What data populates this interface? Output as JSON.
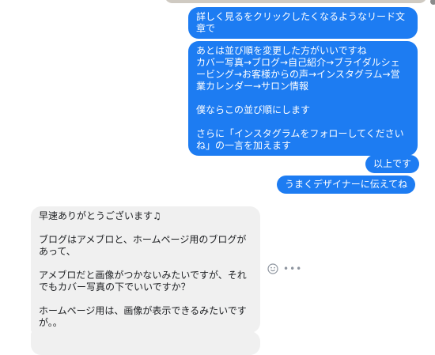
{
  "messages": {
    "out": [
      "詳しく見るをクリックしたくなるようなリード文\n章で",
      "あとは並び順を変更した方がいいですね\nカバー写真→ブログ→自己紹介→ブライダルシェ\nービング→お客様からの声→インスタグラム→営\n業カレンダー→サロン情報\n\n僕ならこの並び順にします\n\nさらに「インスタグラムをフォローしてください\nね」の一言を加えます",
      "以上です",
      "うまくデザイナーに伝えてね"
    ],
    "in": [
      "早速ありがとうございます♫\n\nブログはアメブロと、ホームページ用のブログが\nあって、\n\nアメブロだと画像がつかないみたいですが、それ\nでもカバー写真の下でいいですか？\n\nホームページ用は、画像が表示できるみたいです\nが。。"
    ]
  },
  "actions": {
    "more": "•••"
  },
  "colors": {
    "outgoing": "#1d7cf2",
    "incoming": "#f0f0f0"
  },
  "icons": {
    "react": "smiley-icon",
    "more": "more-icon"
  }
}
